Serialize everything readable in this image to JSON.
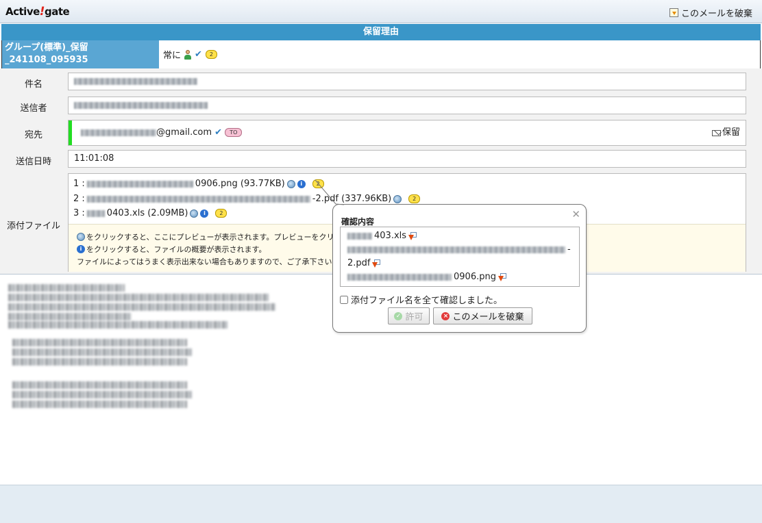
{
  "app": {
    "logo_text_1": "Active",
    "logo_text_2": "!",
    "logo_text_3": "gate",
    "discard_label": "このメールを破棄"
  },
  "reason": {
    "header": "保留理由",
    "group": "グループ(標準)_保留_241108_095935",
    "condition": "常に",
    "badge_count": "2"
  },
  "fields": {
    "subject_label": "件名",
    "sender_label": "送信者",
    "to_label": "宛先",
    "to_suffix": "@gmail.com",
    "to_badge": "TO",
    "hold_label": "保留",
    "date_label": "送信日時",
    "date_value": "11:01:08",
    "attach_label": "添付ファイル"
  },
  "attachments": [
    {
      "index": "1 :",
      "name_tail": "0906.png (93.77KB)",
      "badge": "2"
    },
    {
      "index": "2 :",
      "name_tail": "-2.pdf (337.96KB)",
      "badge": "2"
    },
    {
      "index": "3 :",
      "name_tail": "0403.xls (2.09MB)",
      "badge": "2"
    }
  ],
  "notes": {
    "line1": "をクリックすると、ここにプレビューが表示されます。プレビューをクリ",
    "line2": "をクリックすると、ファイルの概要が表示されます。",
    "line3": "ファイルによってはうまく表示出来ない場合もありますので、ご了承下さい"
  },
  "popup": {
    "title": "確認内容",
    "items": [
      "403.xls",
      "-",
      "2.pdf",
      "0906.png"
    ],
    "checkbox_label": "添付ファイル名を全て確認しました。",
    "allow_label": "許可",
    "discard_label": "このメールを破棄"
  },
  "colors": {
    "header_blue": "#3a96c8",
    "group_cell": "#5aa6d3",
    "green_bar": "#22dd22",
    "note_bg": "#fffbea"
  },
  "icons": [
    "discard-icon",
    "person-icon",
    "check-icon",
    "to-badge",
    "mail-hold-icon",
    "preview-icon",
    "info-icon",
    "download-icon",
    "ok-icon",
    "cross-icon",
    "close-icon"
  ]
}
